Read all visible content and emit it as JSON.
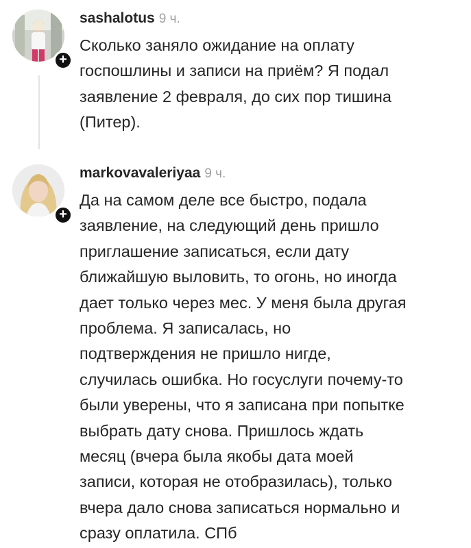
{
  "comments": [
    {
      "username": "sashalotus",
      "time": "9 ч.",
      "follow_badge": "+",
      "avatar_icon": "user-photo-icon",
      "text_lines": [
        "Сколько заняло ожидание на оплату",
        "госпошлины и записи на приём? Я подал",
        "заявление 2 февраля, до сих пор тишина",
        "(Питер)."
      ]
    },
    {
      "username": "markovavaleriyaa",
      "time": "9 ч.",
      "follow_badge": "+",
      "avatar_icon": "user-photo-icon",
      "text_lines": [
        "Да на самом деле все быстро, подала",
        "заявление, на следующий день пришло",
        "приглашение записаться, если дату",
        "ближайшую выловить, то огонь, но иногда",
        "дает только через мес. У меня была другая",
        "проблема. Я записалась, но",
        "подтверждения не пришло нигде,",
        "случилась ошибка. Но госуслуги почему-то",
        "были уверены, что я записана при попытке",
        "выбрать дату снова. Пришлось ждать",
        "месяц (вчера была якобы дата моей",
        "записи, которая не отобразилась), только",
        "вчера дало снова записаться нормально и",
        "сразу оплатила. СПб"
      ]
    }
  ],
  "colors": {
    "text": "#262626",
    "time": "#a0a0a0",
    "badge": "#111111",
    "thread_line": "#e4e4e4"
  }
}
